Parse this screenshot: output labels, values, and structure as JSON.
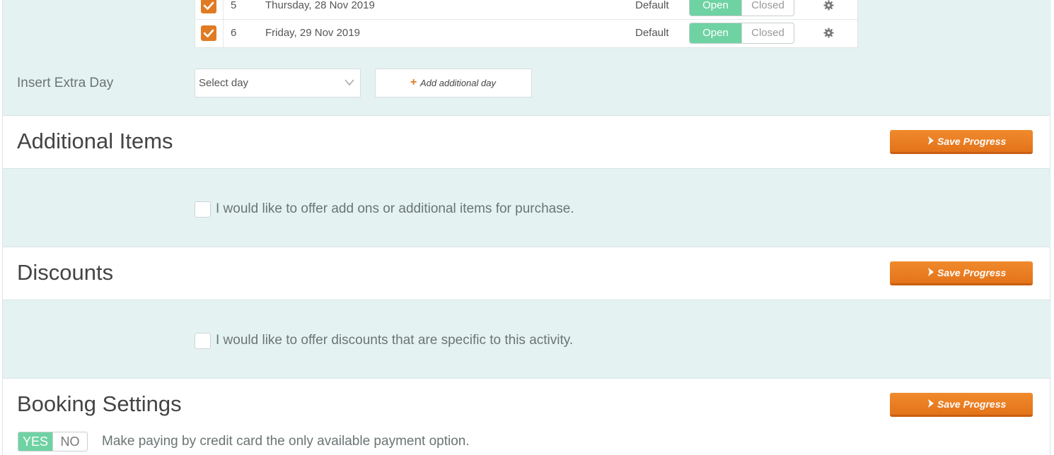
{
  "days": [
    {
      "num": "5",
      "date": "Thursday, 28 Nov 2019",
      "template": "Default",
      "open_label": "Open",
      "closed_label": "Closed"
    },
    {
      "num": "6",
      "date": "Friday, 29 Nov 2019",
      "template": "Default",
      "open_label": "Open",
      "closed_label": "Closed"
    }
  ],
  "extra_day": {
    "label": "Insert Extra Day",
    "select_value": "Select day",
    "add_button_label": "Add additional day"
  },
  "sections": {
    "additional_items": {
      "title": "Additional Items",
      "save_label": "Save Progress",
      "checkbox_label": "I would like to offer add ons or additional items for purchase."
    },
    "discounts": {
      "title": "Discounts",
      "save_label": "Save Progress",
      "checkbox_label": "I would like to offer discounts that are specific to this activity."
    },
    "booking_settings": {
      "title": "Booking Settings",
      "save_label": "Save Progress",
      "yes_label": "YES",
      "no_label": "NO",
      "credit_card_text": "Make paying by credit card the only available payment option."
    }
  },
  "colors": {
    "accent_orange": "#e07b24",
    "toggle_green": "#6fd2a3",
    "teal_bg": "#e4f3f2"
  }
}
